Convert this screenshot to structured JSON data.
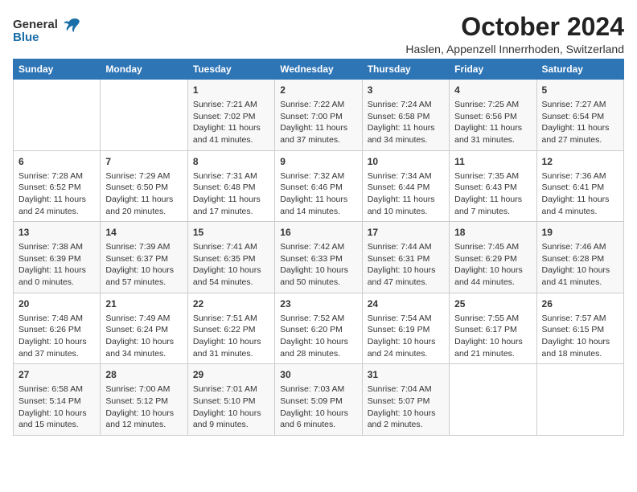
{
  "logo": {
    "general": "General",
    "blue": "Blue"
  },
  "title": "October 2024",
  "location": "Haslen, Appenzell Innerrhoden, Switzerland",
  "headers": [
    "Sunday",
    "Monday",
    "Tuesday",
    "Wednesday",
    "Thursday",
    "Friday",
    "Saturday"
  ],
  "rows": [
    [
      {
        "day": "",
        "info": ""
      },
      {
        "day": "",
        "info": ""
      },
      {
        "day": "1",
        "info": "Sunrise: 7:21 AM\nSunset: 7:02 PM\nDaylight: 11 hours and 41 minutes."
      },
      {
        "day": "2",
        "info": "Sunrise: 7:22 AM\nSunset: 7:00 PM\nDaylight: 11 hours and 37 minutes."
      },
      {
        "day": "3",
        "info": "Sunrise: 7:24 AM\nSunset: 6:58 PM\nDaylight: 11 hours and 34 minutes."
      },
      {
        "day": "4",
        "info": "Sunrise: 7:25 AM\nSunset: 6:56 PM\nDaylight: 11 hours and 31 minutes."
      },
      {
        "day": "5",
        "info": "Sunrise: 7:27 AM\nSunset: 6:54 PM\nDaylight: 11 hours and 27 minutes."
      }
    ],
    [
      {
        "day": "6",
        "info": "Sunrise: 7:28 AM\nSunset: 6:52 PM\nDaylight: 11 hours and 24 minutes."
      },
      {
        "day": "7",
        "info": "Sunrise: 7:29 AM\nSunset: 6:50 PM\nDaylight: 11 hours and 20 minutes."
      },
      {
        "day": "8",
        "info": "Sunrise: 7:31 AM\nSunset: 6:48 PM\nDaylight: 11 hours and 17 minutes."
      },
      {
        "day": "9",
        "info": "Sunrise: 7:32 AM\nSunset: 6:46 PM\nDaylight: 11 hours and 14 minutes."
      },
      {
        "day": "10",
        "info": "Sunrise: 7:34 AM\nSunset: 6:44 PM\nDaylight: 11 hours and 10 minutes."
      },
      {
        "day": "11",
        "info": "Sunrise: 7:35 AM\nSunset: 6:43 PM\nDaylight: 11 hours and 7 minutes."
      },
      {
        "day": "12",
        "info": "Sunrise: 7:36 AM\nSunset: 6:41 PM\nDaylight: 11 hours and 4 minutes."
      }
    ],
    [
      {
        "day": "13",
        "info": "Sunrise: 7:38 AM\nSunset: 6:39 PM\nDaylight: 11 hours and 0 minutes."
      },
      {
        "day": "14",
        "info": "Sunrise: 7:39 AM\nSunset: 6:37 PM\nDaylight: 10 hours and 57 minutes."
      },
      {
        "day": "15",
        "info": "Sunrise: 7:41 AM\nSunset: 6:35 PM\nDaylight: 10 hours and 54 minutes."
      },
      {
        "day": "16",
        "info": "Sunrise: 7:42 AM\nSunset: 6:33 PM\nDaylight: 10 hours and 50 minutes."
      },
      {
        "day": "17",
        "info": "Sunrise: 7:44 AM\nSunset: 6:31 PM\nDaylight: 10 hours and 47 minutes."
      },
      {
        "day": "18",
        "info": "Sunrise: 7:45 AM\nSunset: 6:29 PM\nDaylight: 10 hours and 44 minutes."
      },
      {
        "day": "19",
        "info": "Sunrise: 7:46 AM\nSunset: 6:28 PM\nDaylight: 10 hours and 41 minutes."
      }
    ],
    [
      {
        "day": "20",
        "info": "Sunrise: 7:48 AM\nSunset: 6:26 PM\nDaylight: 10 hours and 37 minutes."
      },
      {
        "day": "21",
        "info": "Sunrise: 7:49 AM\nSunset: 6:24 PM\nDaylight: 10 hours and 34 minutes."
      },
      {
        "day": "22",
        "info": "Sunrise: 7:51 AM\nSunset: 6:22 PM\nDaylight: 10 hours and 31 minutes."
      },
      {
        "day": "23",
        "info": "Sunrise: 7:52 AM\nSunset: 6:20 PM\nDaylight: 10 hours and 28 minutes."
      },
      {
        "day": "24",
        "info": "Sunrise: 7:54 AM\nSunset: 6:19 PM\nDaylight: 10 hours and 24 minutes."
      },
      {
        "day": "25",
        "info": "Sunrise: 7:55 AM\nSunset: 6:17 PM\nDaylight: 10 hours and 21 minutes."
      },
      {
        "day": "26",
        "info": "Sunrise: 7:57 AM\nSunset: 6:15 PM\nDaylight: 10 hours and 18 minutes."
      }
    ],
    [
      {
        "day": "27",
        "info": "Sunrise: 6:58 AM\nSunset: 5:14 PM\nDaylight: 10 hours and 15 minutes."
      },
      {
        "day": "28",
        "info": "Sunrise: 7:00 AM\nSunset: 5:12 PM\nDaylight: 10 hours and 12 minutes."
      },
      {
        "day": "29",
        "info": "Sunrise: 7:01 AM\nSunset: 5:10 PM\nDaylight: 10 hours and 9 minutes."
      },
      {
        "day": "30",
        "info": "Sunrise: 7:03 AM\nSunset: 5:09 PM\nDaylight: 10 hours and 6 minutes."
      },
      {
        "day": "31",
        "info": "Sunrise: 7:04 AM\nSunset: 5:07 PM\nDaylight: 10 hours and 2 minutes."
      },
      {
        "day": "",
        "info": ""
      },
      {
        "day": "",
        "info": ""
      }
    ]
  ]
}
